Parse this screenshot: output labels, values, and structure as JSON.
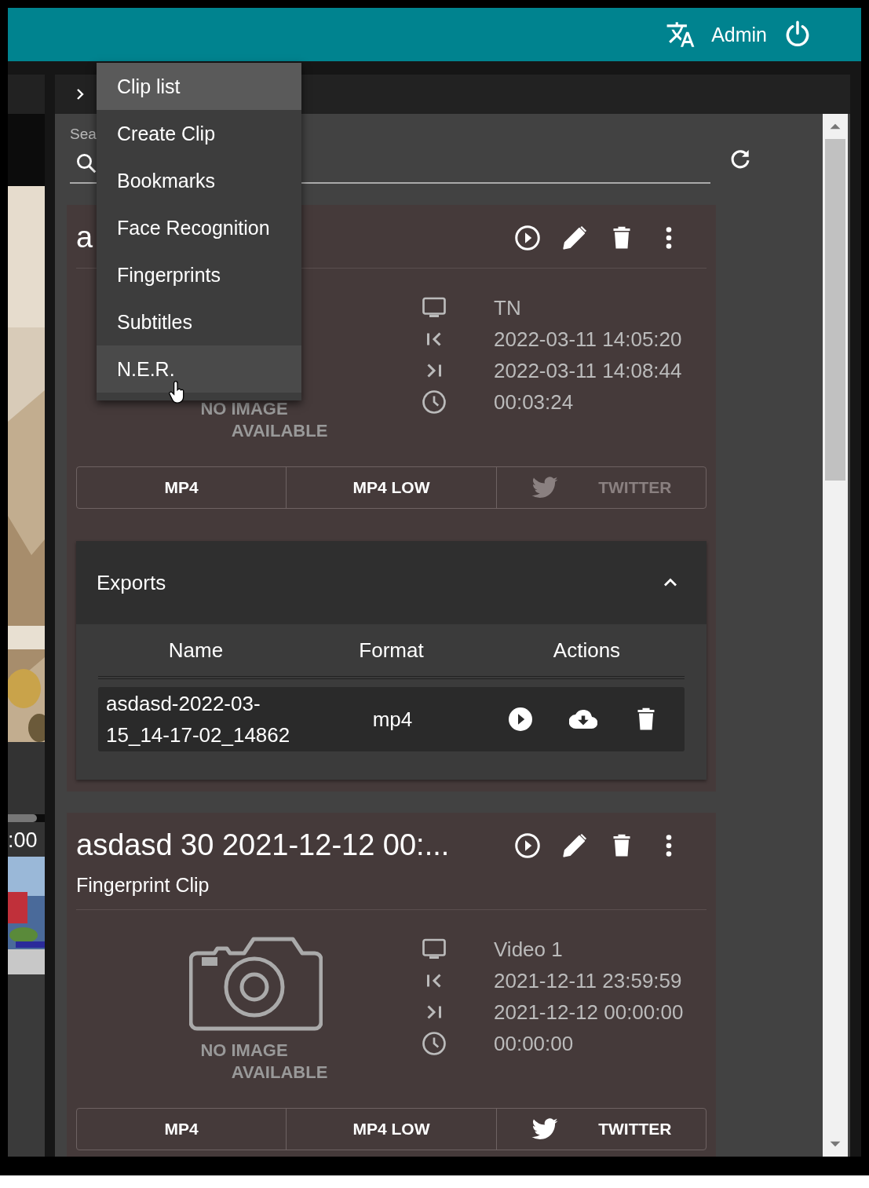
{
  "header": {
    "user": "Admin"
  },
  "left_strip": {
    "time_label": ":00"
  },
  "nav_menu": {
    "items": [
      {
        "label": "Clip list",
        "selected": true,
        "hovered": false
      },
      {
        "label": "Create Clip",
        "selected": false,
        "hovered": false
      },
      {
        "label": "Bookmarks",
        "selected": false,
        "hovered": false
      },
      {
        "label": "Face Recognition",
        "selected": false,
        "hovered": false
      },
      {
        "label": "Fingerprints",
        "selected": false,
        "hovered": false
      },
      {
        "label": "Subtitles",
        "selected": false,
        "hovered": false
      },
      {
        "label": "N.E.R.",
        "selected": false,
        "hovered": true
      }
    ]
  },
  "search": {
    "label": "Sea"
  },
  "clips": [
    {
      "title": "a",
      "camera": false,
      "no_image": [
        "NO IMAGE",
        "AVAILABLE"
      ],
      "info": [
        {
          "kind": "channel",
          "value": "TN"
        },
        {
          "kind": "start",
          "value": "2022-03-11 14:05:20"
        },
        {
          "kind": "end",
          "value": "2022-03-11 14:08:44"
        },
        {
          "kind": "duration",
          "value": "00:03:24"
        }
      ],
      "formats": [
        {
          "kind": "file",
          "label": "MP4",
          "disabled": false
        },
        {
          "kind": "file",
          "label": "MP4 LOW",
          "disabled": false
        },
        {
          "kind": "twitter",
          "label": "TWITTER",
          "disabled": true
        }
      ],
      "exports": {
        "title": "Exports",
        "expanded": true,
        "columns": [
          "Name",
          "Format",
          "Actions"
        ],
        "rows": [
          {
            "name": "asdasd-2022-03-15_14-17-02_14862",
            "format": "mp4"
          }
        ]
      }
    },
    {
      "title": "asdasd 30 2021-12-12 00:...",
      "subtitle": "Fingerprint Clip",
      "camera": true,
      "no_image": [
        "NO IMAGE",
        "AVAILABLE"
      ],
      "info": [
        {
          "kind": "channel",
          "value": "Video 1"
        },
        {
          "kind": "start",
          "value": "2021-12-11 23:59:59"
        },
        {
          "kind": "end",
          "value": "2021-12-12 00:00:00"
        },
        {
          "kind": "duration",
          "value": "00:00:00"
        }
      ],
      "formats": [
        {
          "kind": "file",
          "label": "MP4",
          "disabled": false
        },
        {
          "kind": "file",
          "label": "MP4 LOW",
          "disabled": false
        },
        {
          "kind": "twitter",
          "label": "TWITTER",
          "disabled": false
        }
      ]
    }
  ]
}
